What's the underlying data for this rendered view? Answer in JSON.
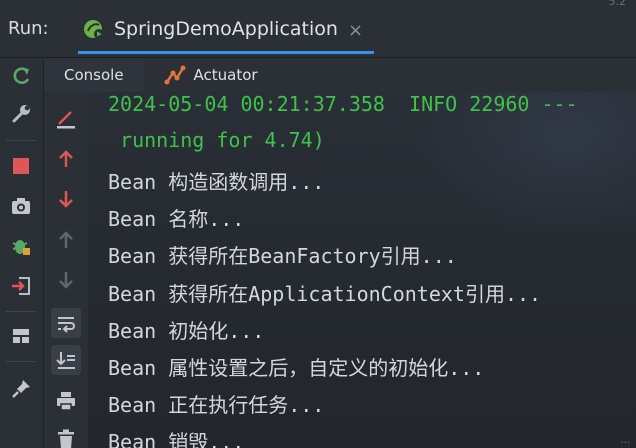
{
  "header": {
    "run_label": "Run:",
    "tab_title": "SpringDemoApplication",
    "tab_close": "×",
    "corner_text": "5.2",
    "accent_color": "#3d8ee6"
  },
  "sub_tabs": [
    {
      "label": "Console",
      "icon": "console-icon"
    },
    {
      "label": "Actuator",
      "icon": "actuator-icon"
    }
  ],
  "left_toolbar": [
    "rerun-icon",
    "wrench-icon",
    "stop-icon",
    "camera-icon",
    "debug-bug-icon",
    "exit-icon",
    "layout-icon",
    "pin-icon"
  ],
  "gutter_toolbar": [
    "clear-line-icon",
    "up-arrow-icon",
    "down-arrow-icon",
    "scroll-up-icon",
    "scroll-down-icon",
    "soft-wrap-icon",
    "scroll-to-end-icon",
    "print-icon",
    "trash-icon"
  ],
  "console": {
    "lines": [
      "2024-05-04 00:21:37.358  INFO 22960 ---",
      " running for 4.74)",
      "Bean 构造函数调用...",
      "Bean 名称...",
      "Bean 获得所在BeanFactory引用...",
      "Bean 获得所在ApplicationContext引用...",
      "Bean 初始化...",
      "Bean 属性设置之后，自定义的初始化...",
      "Bean 正在执行任务...",
      "Bean 销毁..."
    ],
    "log_color": "#3fc24a",
    "text_color": "#d4d8dd"
  },
  "corner_bottom_text": "..."
}
